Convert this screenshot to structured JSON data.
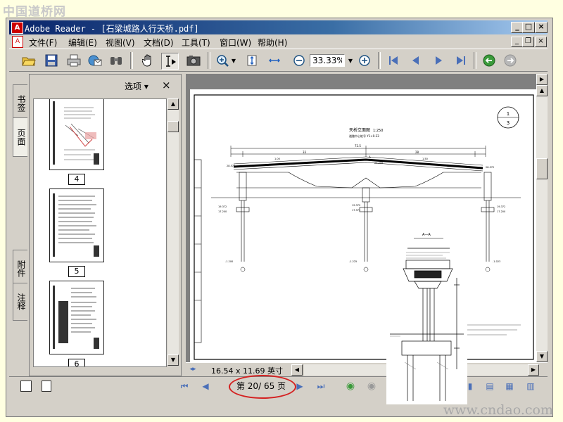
{
  "watermark": {
    "top": "中国道桥网",
    "bottom": "www.cndao.com"
  },
  "window": {
    "title": "Adobe Reader - [石梁城路人行天桥.pdf]",
    "min": "_",
    "max": "□",
    "close": "×"
  },
  "menu": {
    "items": [
      "文件(F)",
      "编辑(E)",
      "视图(V)",
      "文档(D)",
      "工具(T)",
      "窗口(W)",
      "帮助(H)"
    ],
    "doc_min": "_",
    "doc_restore": "❐",
    "doc_close": "×"
  },
  "toolbar": {
    "zoom": "33.33%"
  },
  "side_tabs": [
    "书签",
    "页面",
    "附件",
    "注释"
  ],
  "nav_panel": {
    "options_label": "选项 ▾",
    "close": "×",
    "thumbnails": [
      "4",
      "5",
      "6"
    ]
  },
  "document": {
    "page_size": "16.54 x 11.69 英寸",
    "drawing": {
      "title": "天桥立面图",
      "scale": "1:250",
      "subtitle": "道路中心桩号 Y1+0-23",
      "sheet_num": "1",
      "sheet_total": "3",
      "span_left": "33",
      "span_right": "28",
      "total_span": "72.5",
      "section_label": "A—A",
      "label_A": "A",
      "dim_1": "1.00",
      "dim_2": "1.50",
      "dim_3": "28.577",
      "dim_4": "29.000",
      "dim_5": "28.572",
      "dim_6": "19.372",
      "dim_7": "17.200",
      "dim_8": "17.971",
      "dim_9": "-1.200",
      "dim_10": "-1.225",
      "dim_11": "-1.023"
    }
  },
  "status": {
    "current_page": "20",
    "total_pages": "65",
    "page_prefix": "第",
    "page_sep": "/",
    "page_suffix": "页"
  }
}
